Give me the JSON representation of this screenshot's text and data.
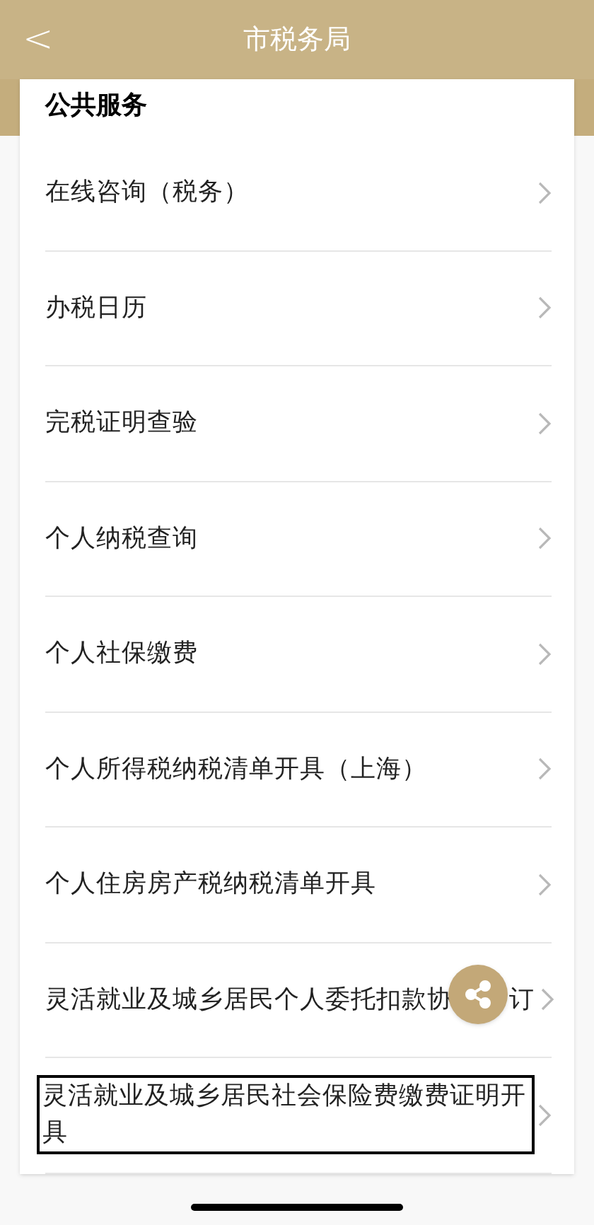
{
  "header": {
    "back": "<",
    "title": "市税务局"
  },
  "section": {
    "title": "公共服务"
  },
  "items": [
    {
      "label": "在线咨询（税务）",
      "focused": false
    },
    {
      "label": "办税日历",
      "focused": false
    },
    {
      "label": "完税证明查验",
      "focused": false
    },
    {
      "label": "个人纳税查询",
      "focused": false
    },
    {
      "label": "个人社保缴费",
      "focused": false
    },
    {
      "label": "个人所得税纳税清单开具（上海）",
      "focused": false
    },
    {
      "label": "个人住房房产税纳税清单开具",
      "focused": false
    },
    {
      "label": "灵活就业及城乡居民个人委托扣款协",
      "label_end": "订",
      "focused": false
    },
    {
      "label": "灵活就业及城乡居民社会保险费缴费证明开具",
      "focused": true
    }
  ]
}
